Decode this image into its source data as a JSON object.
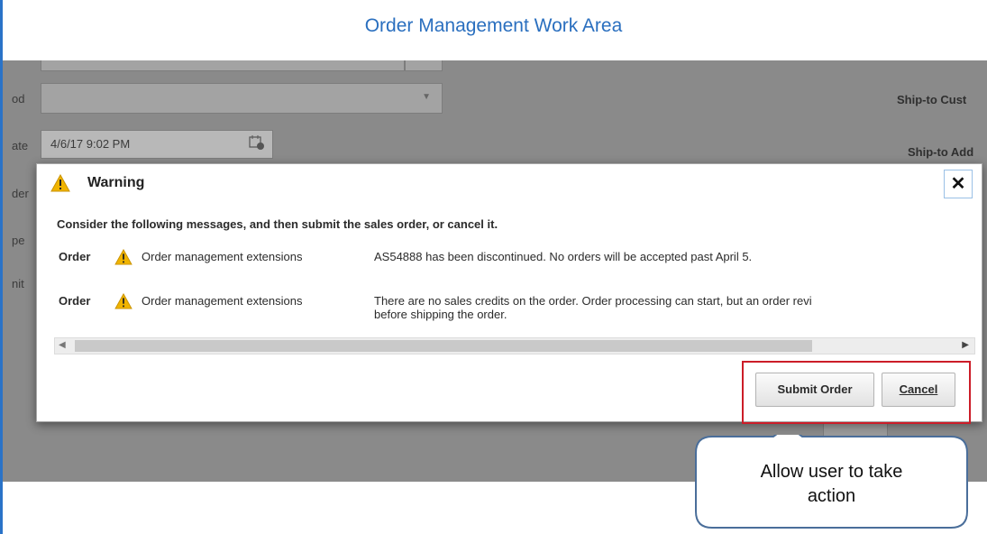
{
  "page": {
    "title": "Order Management Work Area"
  },
  "background_form": {
    "labels": [
      "od",
      "ate",
      "der",
      "pe",
      "nit"
    ],
    "date_value": "4/6/17 9:02 PM",
    "right_labels": [
      "Ship-to Cust",
      "Ship-to Add"
    ]
  },
  "dialog": {
    "title": "Warning",
    "close_symbol": "✕",
    "intro": "Consider the following messages, and then submit the sales order, or cancel it.",
    "messages": [
      {
        "type": "Order",
        "source": "Order management extensions",
        "text_line1": "AS54888 has been discontinued. No orders will be accepted past April 5.",
        "text_line2": ""
      },
      {
        "type": "Order",
        "source": "Order management extensions",
        "text_line1": "There are no sales credits on the order. Order processing can start, but an order revi",
        "text_line2": "before shipping the order."
      }
    ],
    "buttons": {
      "submit": "Submit Order",
      "cancel": "Cancel"
    }
  },
  "callout": {
    "line1": "Allow user to take",
    "line2": "action"
  },
  "colors": {
    "title": "#2a6fbf",
    "highlight": "#cc1d28",
    "warning_icon": "#f0b400",
    "callout_border": "#4a6e9a"
  },
  "icons": [
    "warning-icon",
    "close-icon",
    "calendar-icon",
    "dropdown-arrow-icon",
    "scroll-left-icon",
    "scroll-right-icon"
  ]
}
